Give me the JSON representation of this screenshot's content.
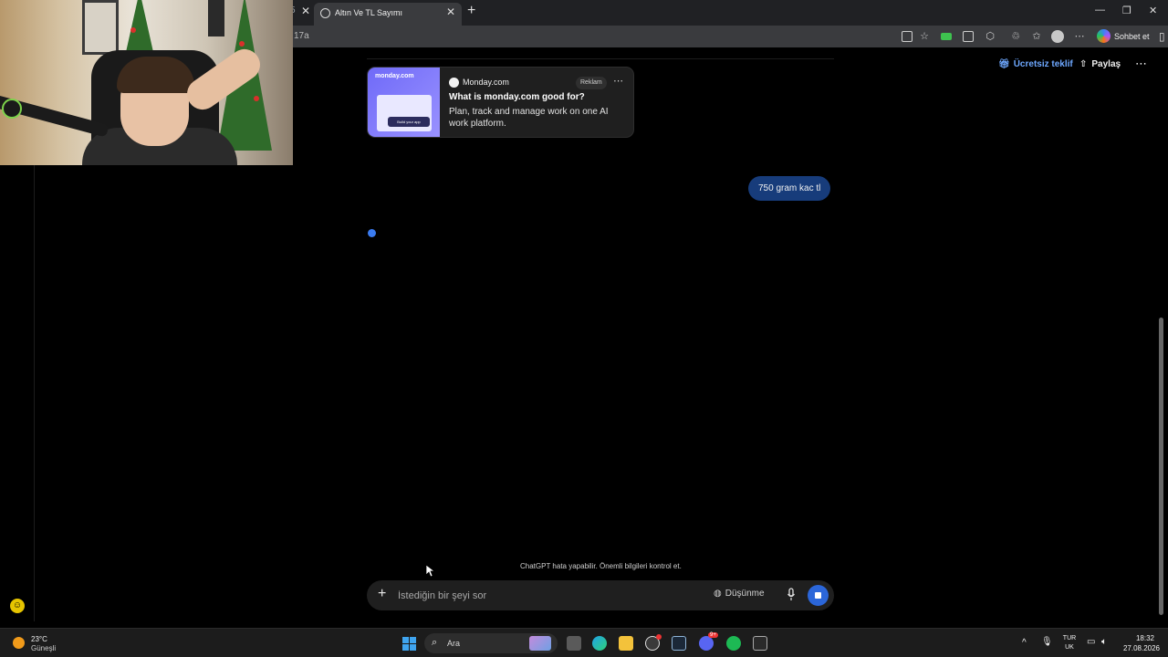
{
  "browser": {
    "prev_tab_fragment": "5",
    "active_tab_title": "Altın Ve TL Sayımı",
    "url_fragment": "17a",
    "copilot_label": "Sohbet et"
  },
  "header": {
    "offer_label": "Ücretsiz teklif",
    "share_label": "Paylaş"
  },
  "ad": {
    "image_logo": "monday.com",
    "image_button": "Build your app",
    "source": "Monday.com",
    "badge": "Reklam",
    "title": "What is monday.com good for?",
    "description": "Plan, track and manage work on one AI work platform."
  },
  "chat": {
    "user_message": "750 gram kac tl",
    "disclaimer": "ChatGPT hata yapabilir. Önemli bilgileri kontrol et."
  },
  "composer": {
    "placeholder": "İstediğin bir şeyi sor",
    "think_label": "Düşünme"
  },
  "taskbar": {
    "weather_temp": "23°C",
    "weather_desc": "Güneşli",
    "search_label": "Ara",
    "lang_top": "TUR",
    "lang_bottom": "UK",
    "time": "18:32",
    "date": "27.08.2026",
    "badge_count": "9+"
  },
  "colors": {
    "accent_blue": "#2b66d9",
    "user_bubble": "#173c7b",
    "offer_link": "#6ea8ff"
  }
}
